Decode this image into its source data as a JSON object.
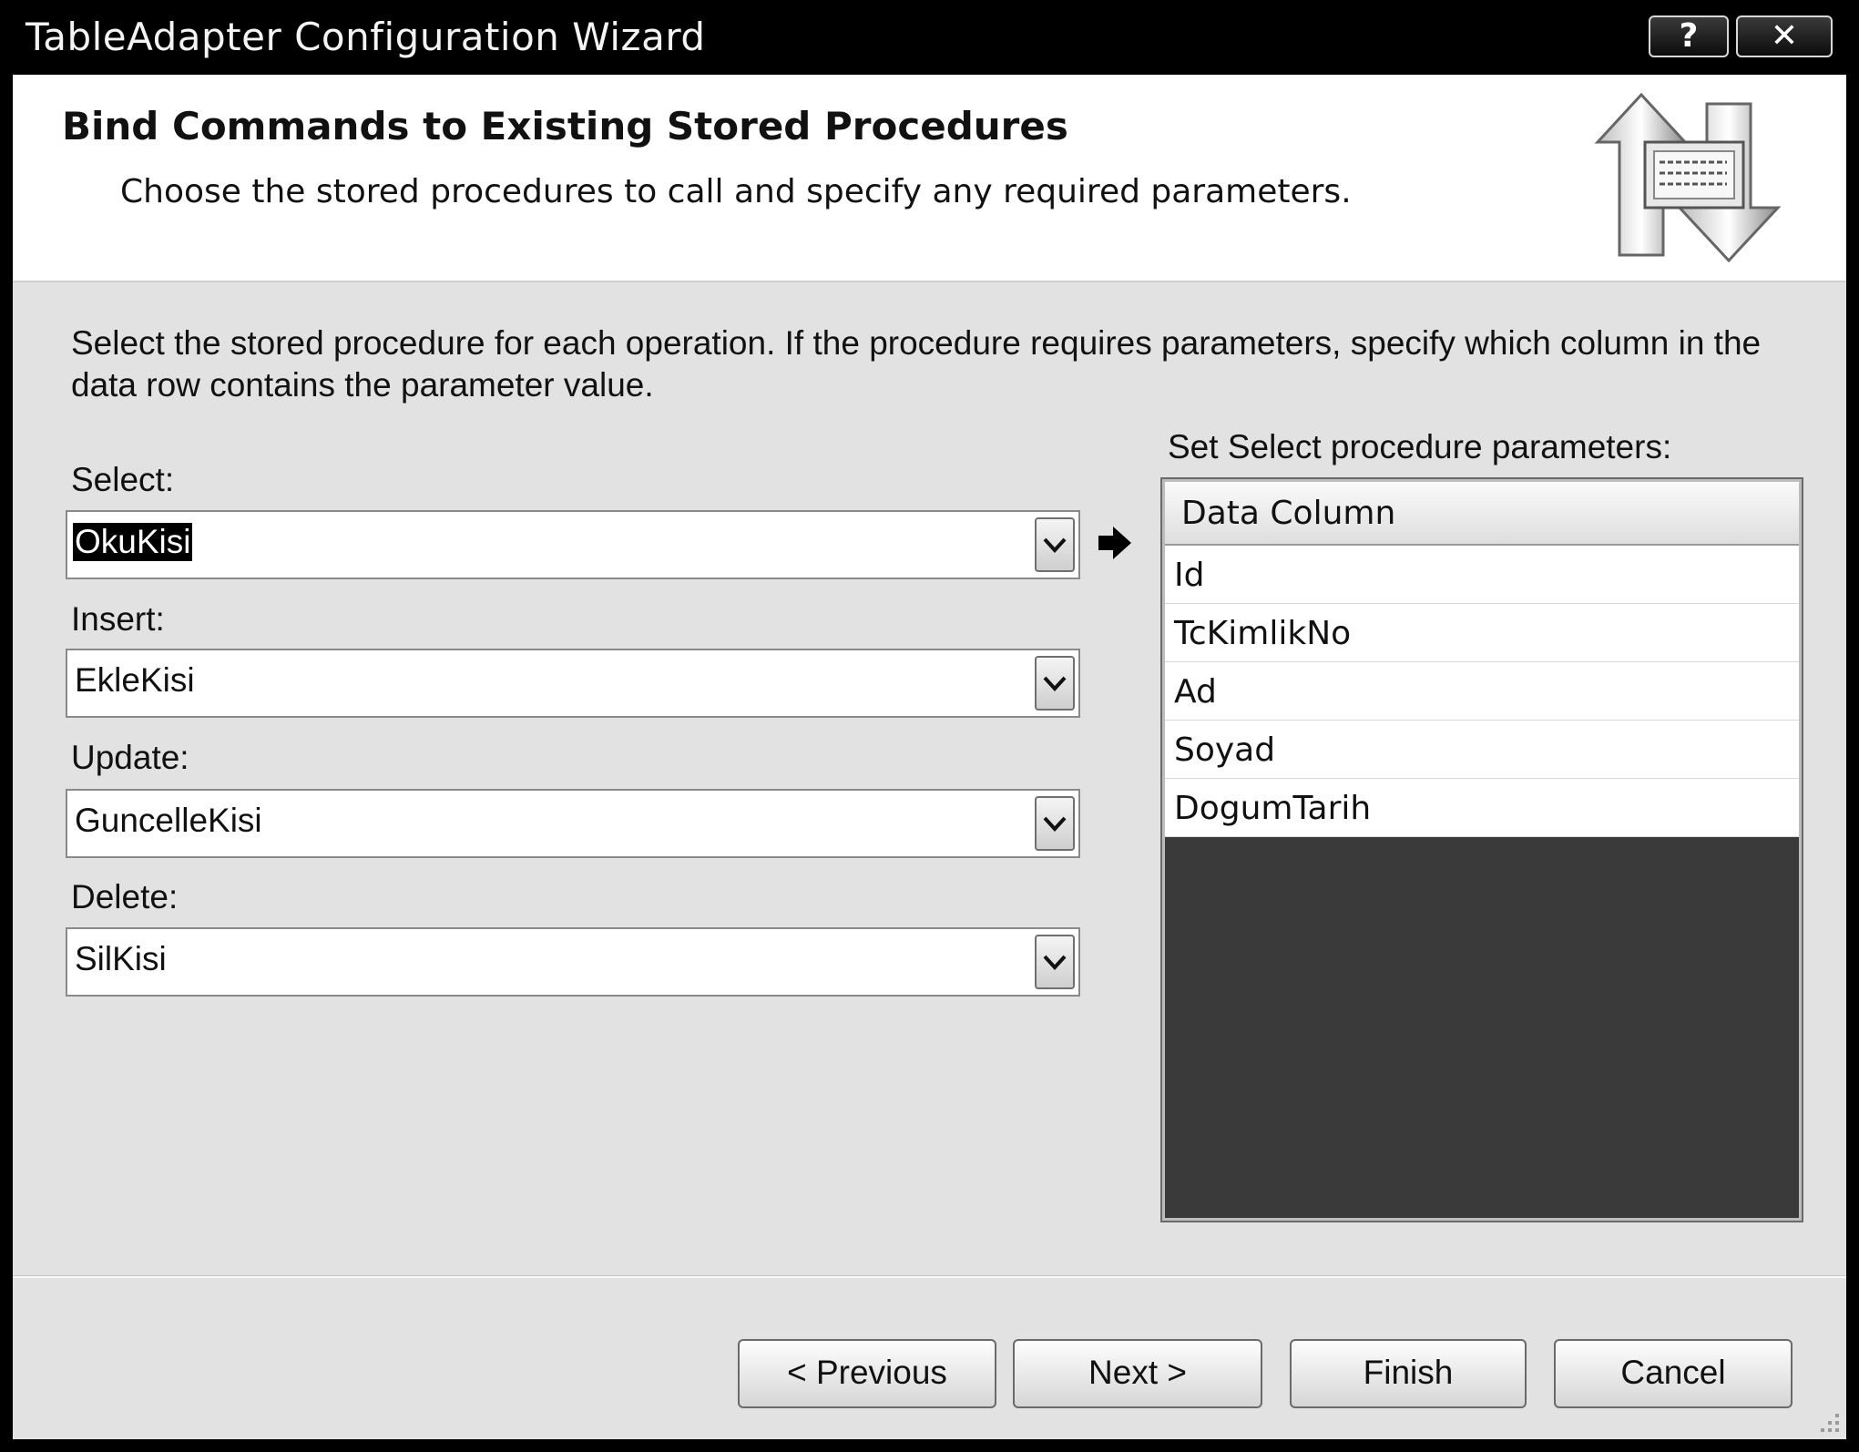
{
  "window": {
    "title": "TableAdapter Configuration Wizard",
    "help_glyph": "?",
    "close_glyph": "✕"
  },
  "header": {
    "title": "Bind Commands to Existing Stored Procedures",
    "subtitle": "Choose the stored procedures to call and specify any required parameters."
  },
  "instructions": "Select the stored procedure for each operation. If the procedure requires parameters, specify which column in the data row contains the parameter value.",
  "operations": [
    {
      "label": "Select:",
      "value": "OkuKisi",
      "selected_text": true
    },
    {
      "label": "Insert:",
      "value": "EkleKisi"
    },
    {
      "label": "Update:",
      "value": "GuncelleKisi"
    },
    {
      "label": "Delete:",
      "value": "SilKisi"
    }
  ],
  "parameters": {
    "label": "Set Select procedure parameters:",
    "column_header": "Data Column",
    "rows": [
      "Id",
      "TcKimlikNo",
      "Ad",
      "Soyad",
      "DogumTarih"
    ]
  },
  "buttons": {
    "previous": "< Previous",
    "next": "Next >",
    "finish": "Finish",
    "cancel": "Cancel"
  },
  "icons": {
    "header": "database-sync-arrows-icon",
    "pointer": "right-arrow-icon",
    "dropdown": "chevron-down-icon",
    "resize": "resize-grip-icon"
  }
}
